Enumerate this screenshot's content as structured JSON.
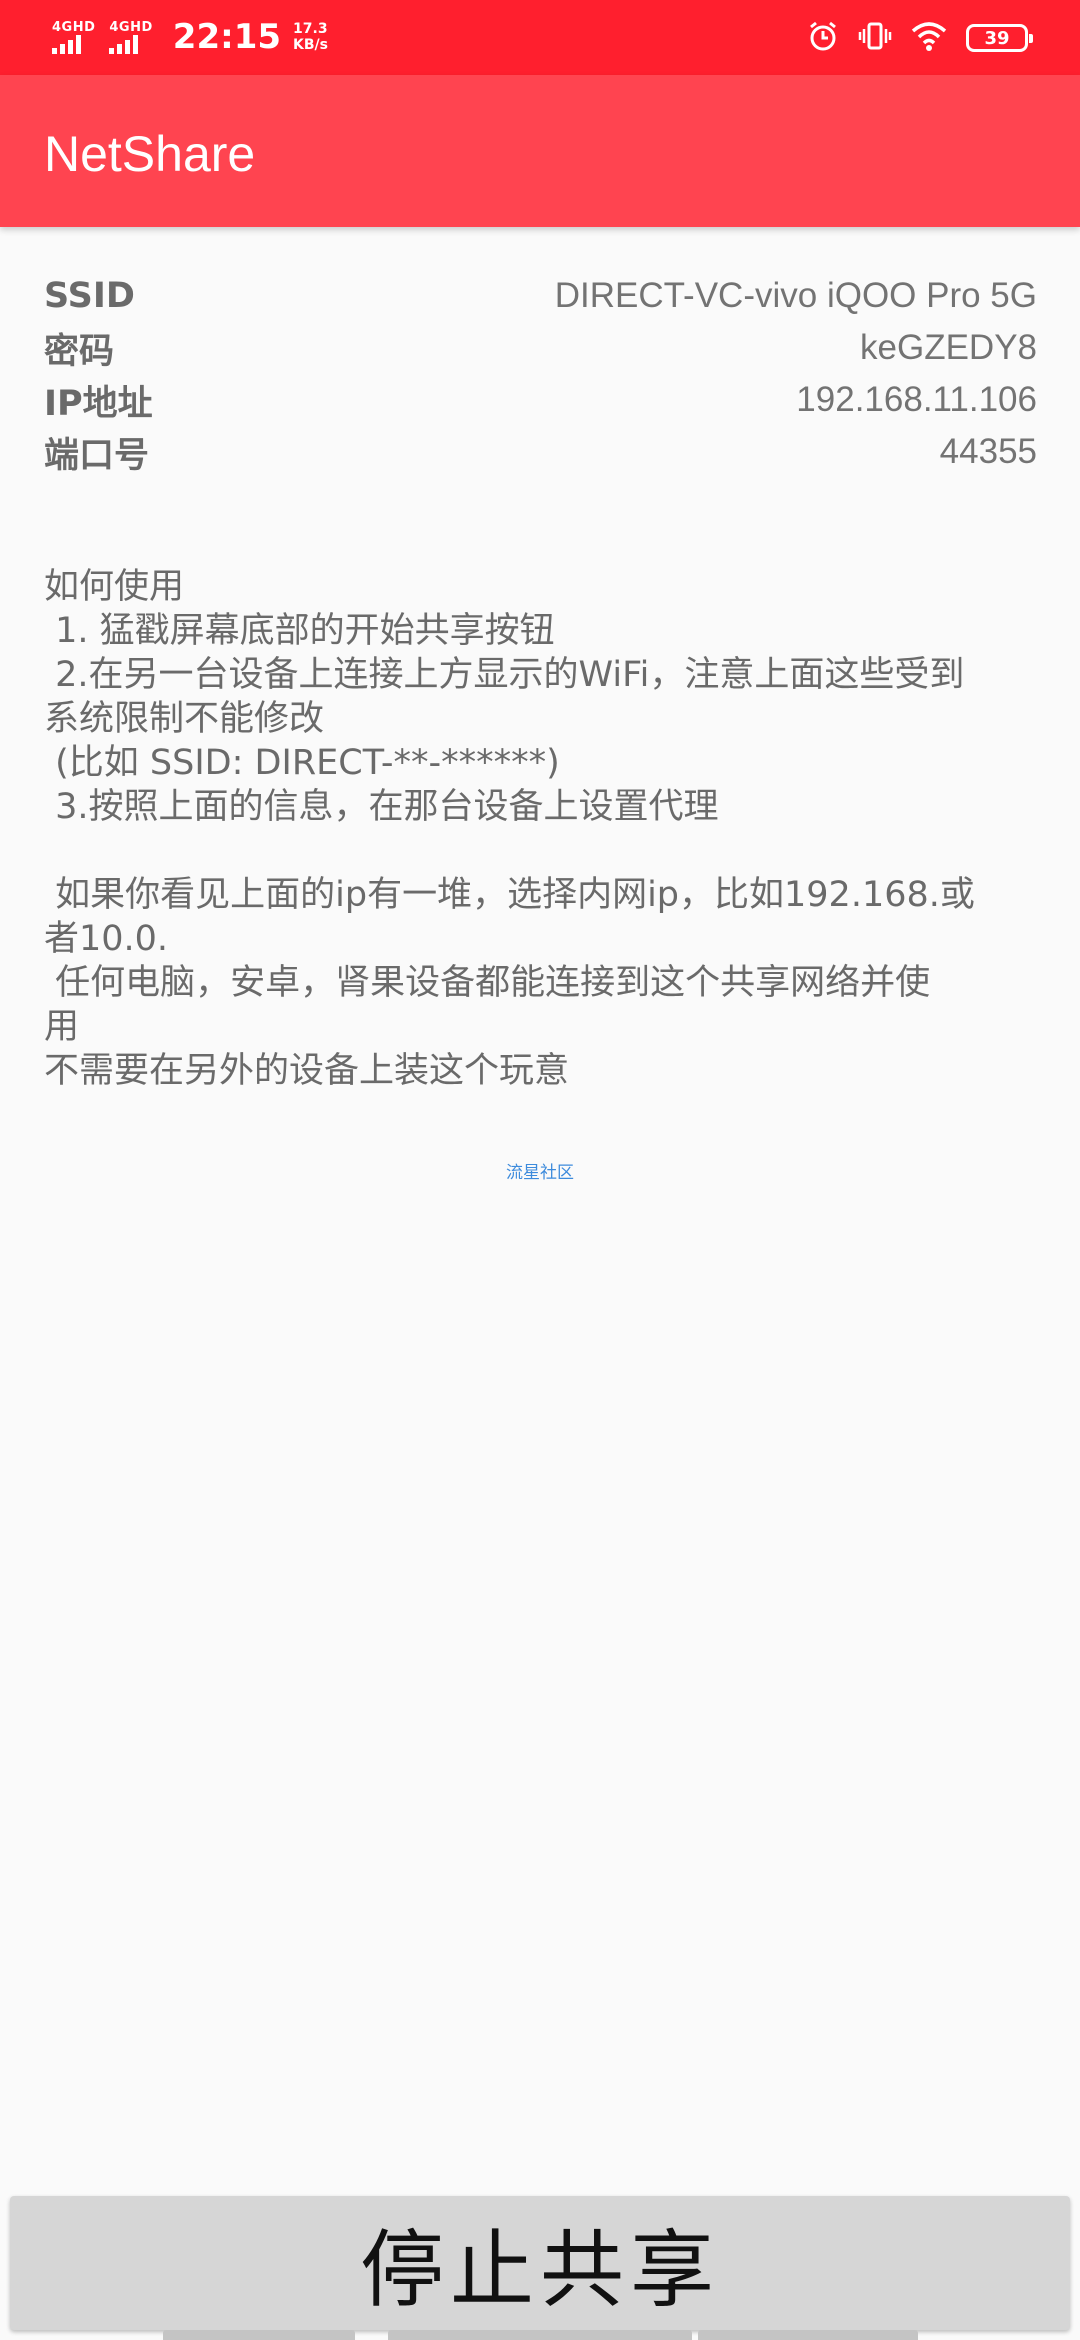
{
  "status_bar": {
    "network_1": "4GHD",
    "network_2": "4GHD",
    "time": "22:15",
    "speed_value": "17.3",
    "speed_unit": "KB/s",
    "battery": "39",
    "icons": [
      "alarm-icon",
      "vibrate-icon",
      "wifi-icon",
      "battery-icon"
    ]
  },
  "app_bar": {
    "title": "NetShare"
  },
  "info": {
    "rows": [
      {
        "label": "SSID",
        "value": "DIRECT-VC-vivo iQOO Pro 5G"
      },
      {
        "label": "密码",
        "value": "keGZEDY8"
      },
      {
        "label": "IP地址",
        "value": "192.168.11.106"
      },
      {
        "label": "端口号",
        "value": "44355"
      }
    ]
  },
  "instructions": {
    "text": "如何使用\n 1. 猛戳屏幕底部的开始共享按钮\n 2.在另一台设备上连接上方显示的WiFi，注意上面这些受到\n系统限制不能修改\n (比如 SSID: DIRECT-**-******)\n 3.按照上面的信息，在那台设备上设置代理\n\n 如果你看见上面的ip有一堆，选择内网ip，比如192.168.或\n者10.0.\n 任何电脑，安卓，肾果设备都能连接到这个共享网络并使\n用\n不需要在另外的设备上装这个玩意"
  },
  "link": {
    "label": "流星社区"
  },
  "bottom_button": {
    "label": "停止共享"
  },
  "colors": {
    "status_bar": "#ff1f2e",
    "app_bar": "#ff4450",
    "link": "#3d8bdc"
  }
}
